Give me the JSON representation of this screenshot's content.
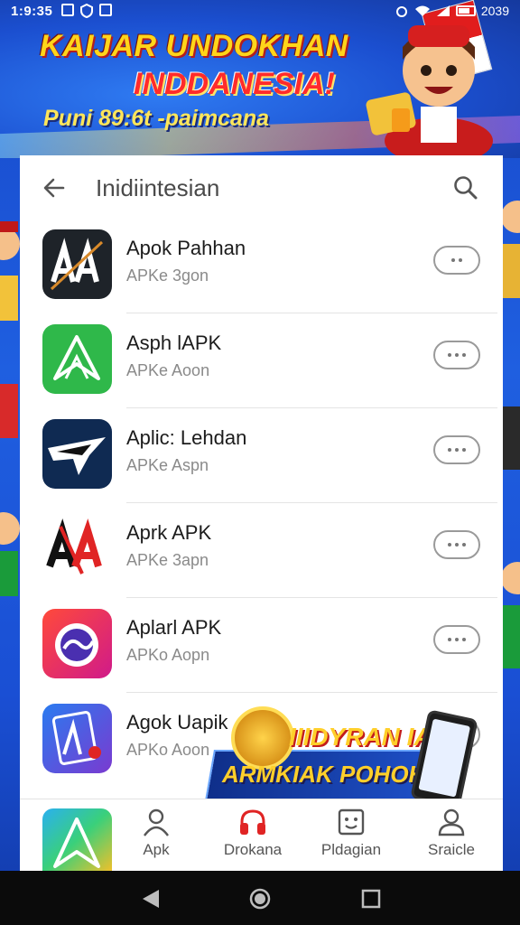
{
  "status_bar": {
    "time": "1:9:35",
    "battery_text": "2039"
  },
  "banner": {
    "headline": "KAIJAR UNDOKHAN",
    "headline2": "INDDANESIA!",
    "subtitle": "Puni 89:6t -paimcana"
  },
  "toolbar": {
    "title": "Inidiintesian"
  },
  "apps": [
    {
      "name": "Apok Pahhan",
      "sub": "APKe 3gon"
    },
    {
      "name": "Asph lAPK",
      "sub": "APKe Aoon"
    },
    {
      "name": "Aplic: Lehdan",
      "sub": "APKe Aspn"
    },
    {
      "name": "Aprk APK",
      "sub": "APKe 3apn"
    },
    {
      "name": "Aplarl APK",
      "sub": "APKo Aopn"
    },
    {
      "name": "Agok Uapik",
      "sub": "APKo Aoon"
    }
  ],
  "promo": {
    "line1": "IIIDYRAN IAN",
    "line2": "ARMKIAK POHOH"
  },
  "bottom_nav": {
    "items": [
      {
        "label": "Apk",
        "icon": "person-icon"
      },
      {
        "label": "Drokana",
        "icon": "headphones-icon"
      },
      {
        "label": "Pldagian",
        "icon": "face-frame-icon"
      },
      {
        "label": "Sraicle",
        "icon": "profile-icon"
      }
    ]
  },
  "colors": {
    "accent_red": "#e02424",
    "banner_blue": "#1b4fd0",
    "headline_yellow": "#ffd51a"
  }
}
